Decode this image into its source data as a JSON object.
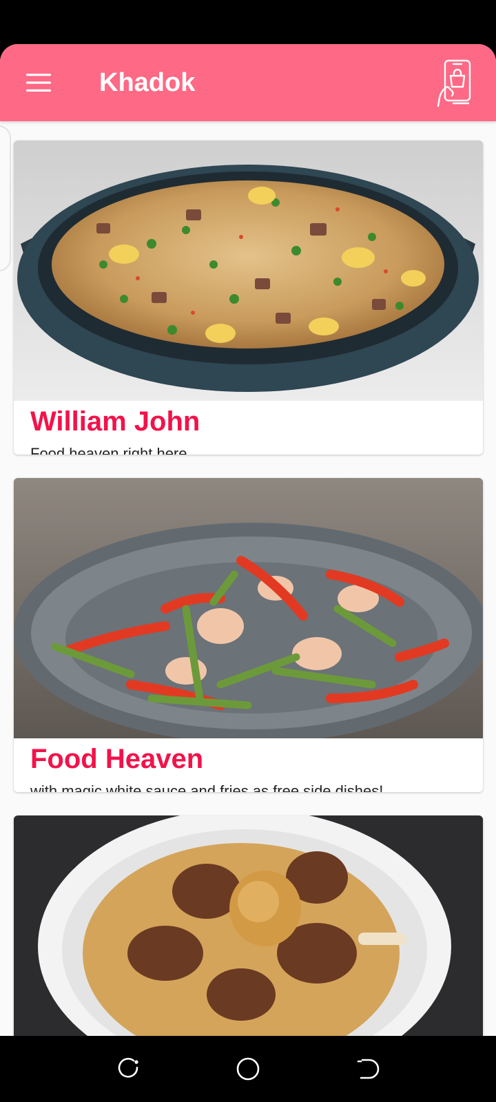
{
  "app": {
    "title": "Khadok",
    "accent_color": "#fe6985",
    "title_color": "#f2124a",
    "menu_icon": "hamburger-menu-icon",
    "order_icon": "phone-order-icon"
  },
  "restaurants": [
    {
      "name": "William John",
      "description": "Food heaven right here",
      "image": "fried-rice-bowl-photo"
    },
    {
      "name": "Food Heaven",
      "description": "with magic white sauce and fries as free side dishes!",
      "image": "shrimp-stir-fry-photo"
    },
    {
      "name": "",
      "description": "",
      "image": "mutton-biryani-plate-photo"
    }
  ],
  "navigation": {
    "recent_icon": "recent-apps-icon",
    "home_icon": "home-circle-icon",
    "back_icon": "back-icon"
  }
}
